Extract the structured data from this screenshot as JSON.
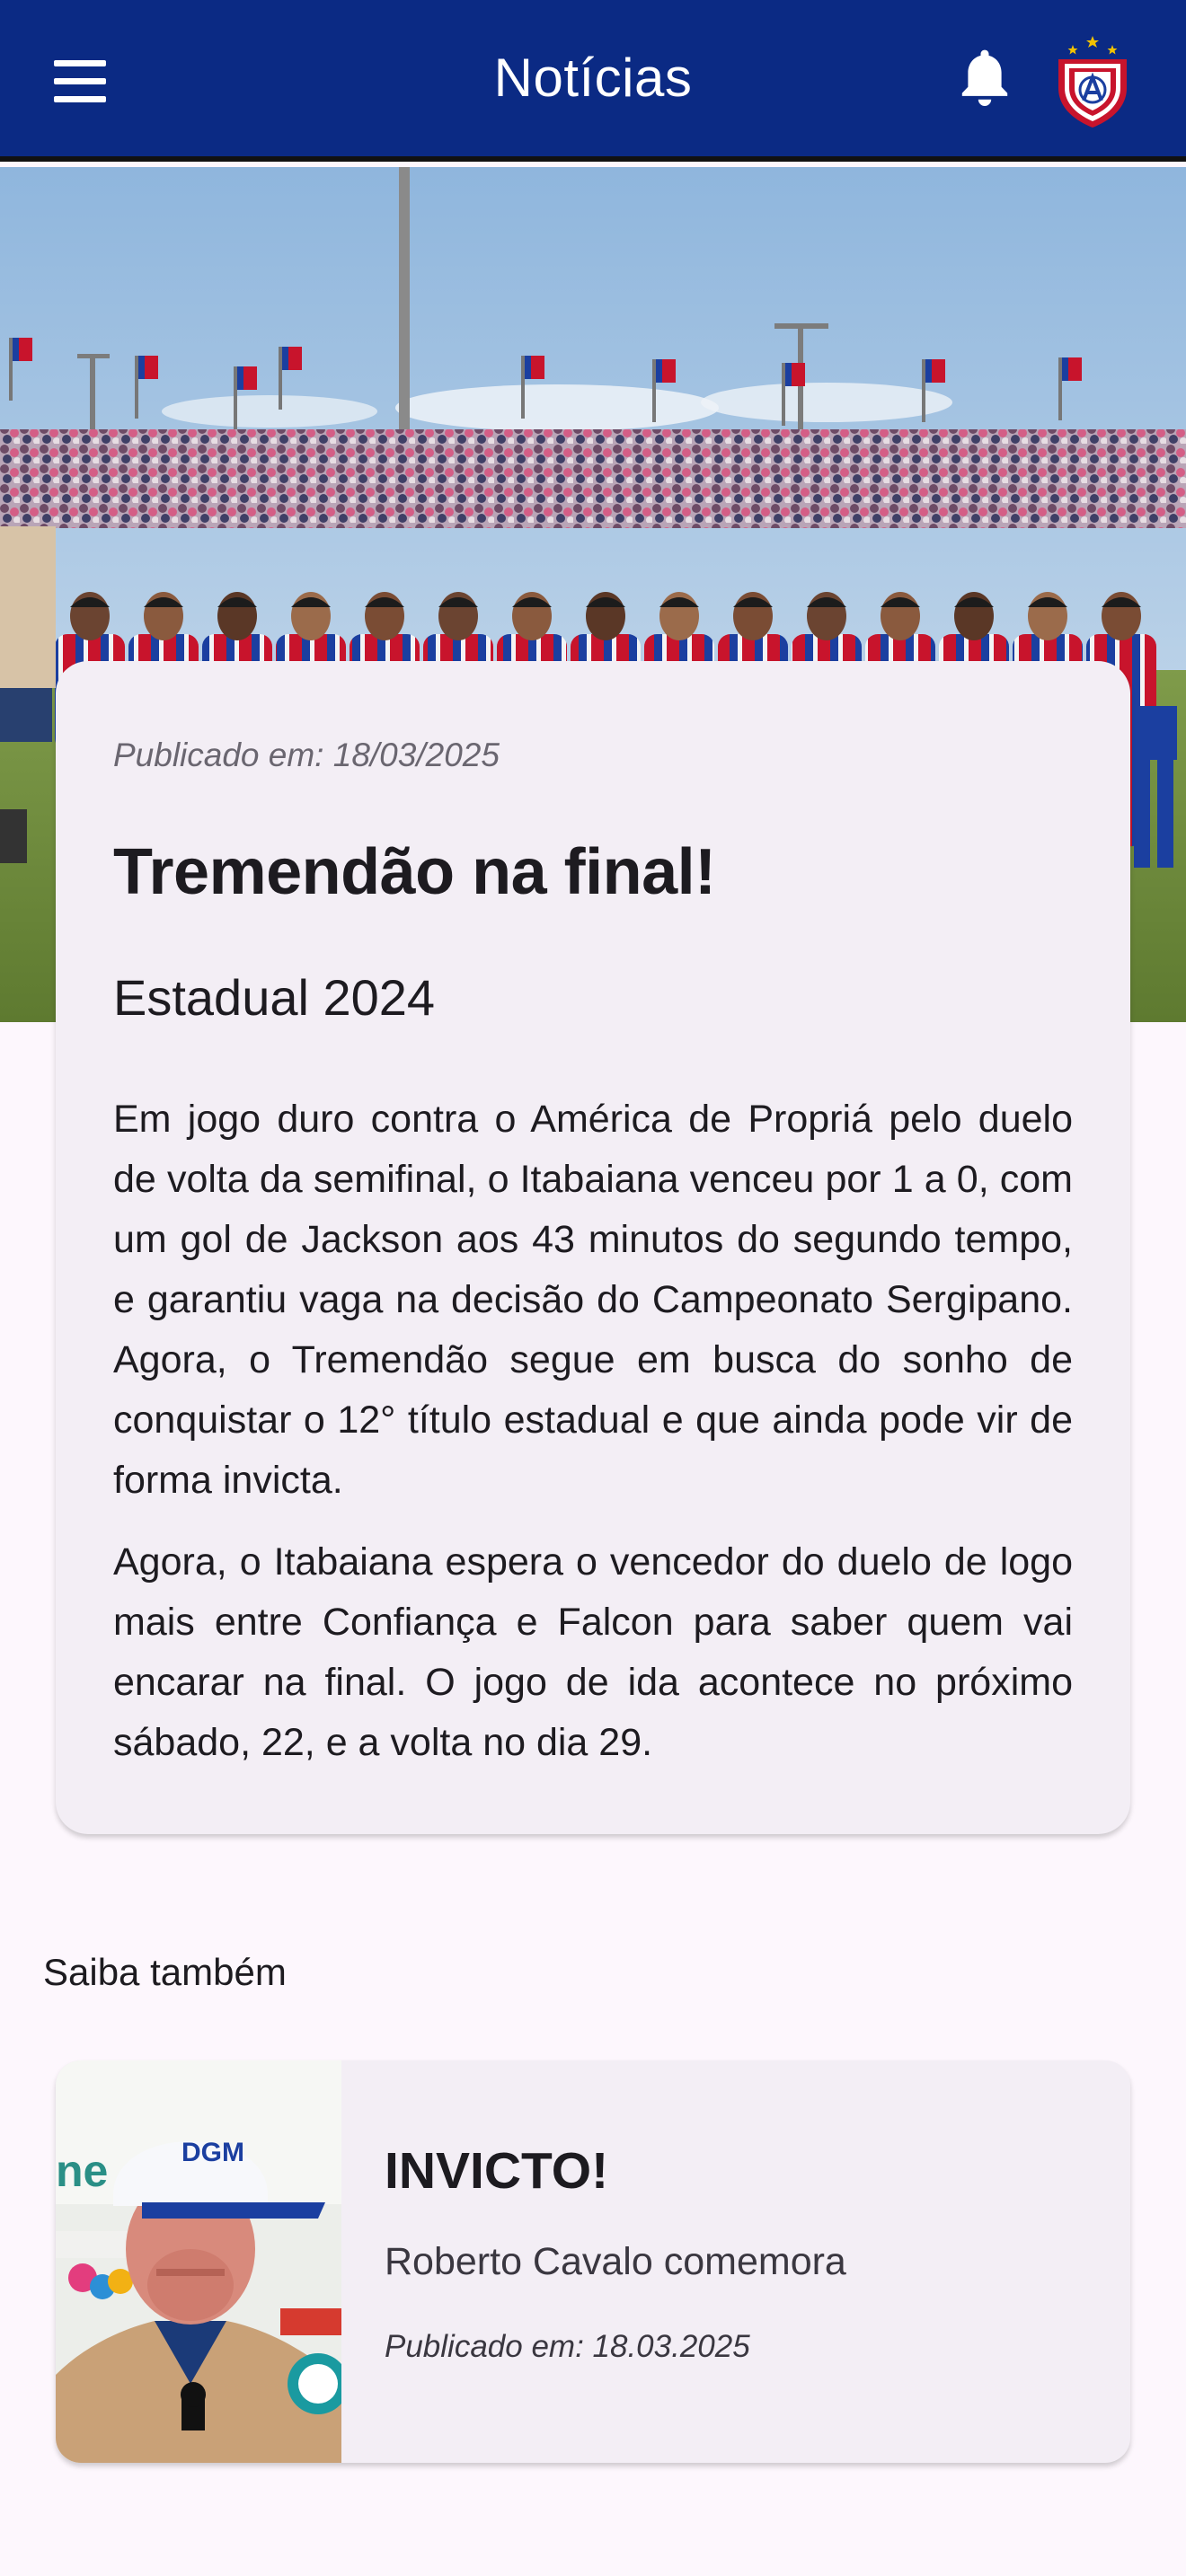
{
  "app_bar": {
    "title": "Notícias",
    "menu_icon": "menu-icon",
    "notification_icon": "bell-icon",
    "logo_icon": "club-crest-icon"
  },
  "article": {
    "published": "Publicado em: 18/03/2025",
    "title": "Tremendão na final!",
    "subtitle": "Estadual 2024",
    "paragraphs": [
      "Em jogo duro contra o América de Propriá pelo duelo de volta da semifinal, o Itabaiana venceu por 1 a 0, com um gol de Jackson aos 43 minutos do segundo tempo, e garantiu vaga na decisão do Campeonato Sergipano. Agora, o Tremendão segue em busca do sonho de conquistar o 12° título estadual e que ainda pode vir de forma invicta.",
      "Agora, o Itabaiana espera o vencedor do duelo de logo mais entre Confiança e Falcon para saber quem vai encarar na final. O jogo de ida acontece no próximo sábado, 22, e a volta no dia 29."
    ]
  },
  "related": {
    "heading": "Saiba também",
    "items": [
      {
        "title": "INVICTO!",
        "subtitle": "Roberto Cavalo comemora",
        "published": "Publicado em: 18.03.2025",
        "cap_logo_text": "DGM",
        "banner_text": "ne"
      }
    ]
  },
  "colors": {
    "app_bar": "#0b2a84",
    "background": "#fdf7fd",
    "card": "#f3eef5",
    "kit_red": "#c8142c",
    "kit_blue": "#1b3fa0"
  }
}
